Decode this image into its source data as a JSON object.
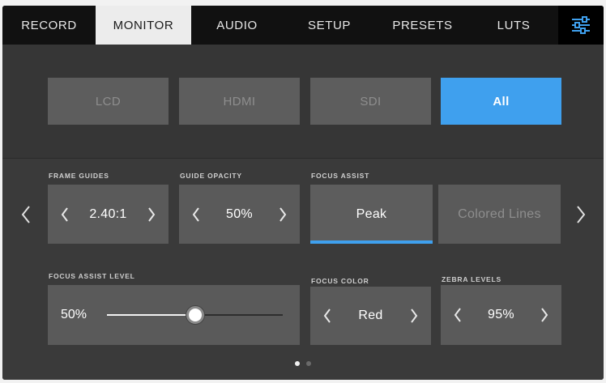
{
  "tabs": [
    {
      "label": "RECORD",
      "active": false
    },
    {
      "label": "MONITOR",
      "active": true
    },
    {
      "label": "AUDIO",
      "active": false
    },
    {
      "label": "SETUP",
      "active": false
    },
    {
      "label": "PRESETS",
      "active": false
    },
    {
      "label": "LUTS",
      "active": false
    }
  ],
  "settings_icon": "sliders-icon",
  "outputs": [
    {
      "label": "LCD",
      "selected": false
    },
    {
      "label": "HDMI",
      "selected": false
    },
    {
      "label": "SDI",
      "selected": false
    },
    {
      "label": "All",
      "selected": true
    }
  ],
  "frame_guides": {
    "label": "FRAME GUIDES",
    "value": "2.40:1"
  },
  "guide_opacity": {
    "label": "GUIDE OPACITY",
    "value": "50%"
  },
  "focus_assist": {
    "label": "FOCUS ASSIST",
    "options": [
      {
        "label": "Peak",
        "selected": true
      },
      {
        "label": "Colored Lines",
        "selected": false
      }
    ]
  },
  "focus_assist_level": {
    "label": "FOCUS ASSIST LEVEL",
    "value": "50%",
    "level": 0.5
  },
  "focus_color": {
    "label": "FOCUS COLOR",
    "value": "Red"
  },
  "zebra_levels": {
    "label": "ZEBRA LEVELS",
    "value": "95%"
  },
  "pagination": {
    "pages": 2,
    "current": 1
  },
  "colors": {
    "accent": "#3fa0ee",
    "panel": "#363636",
    "card": "#5a5a5a"
  }
}
